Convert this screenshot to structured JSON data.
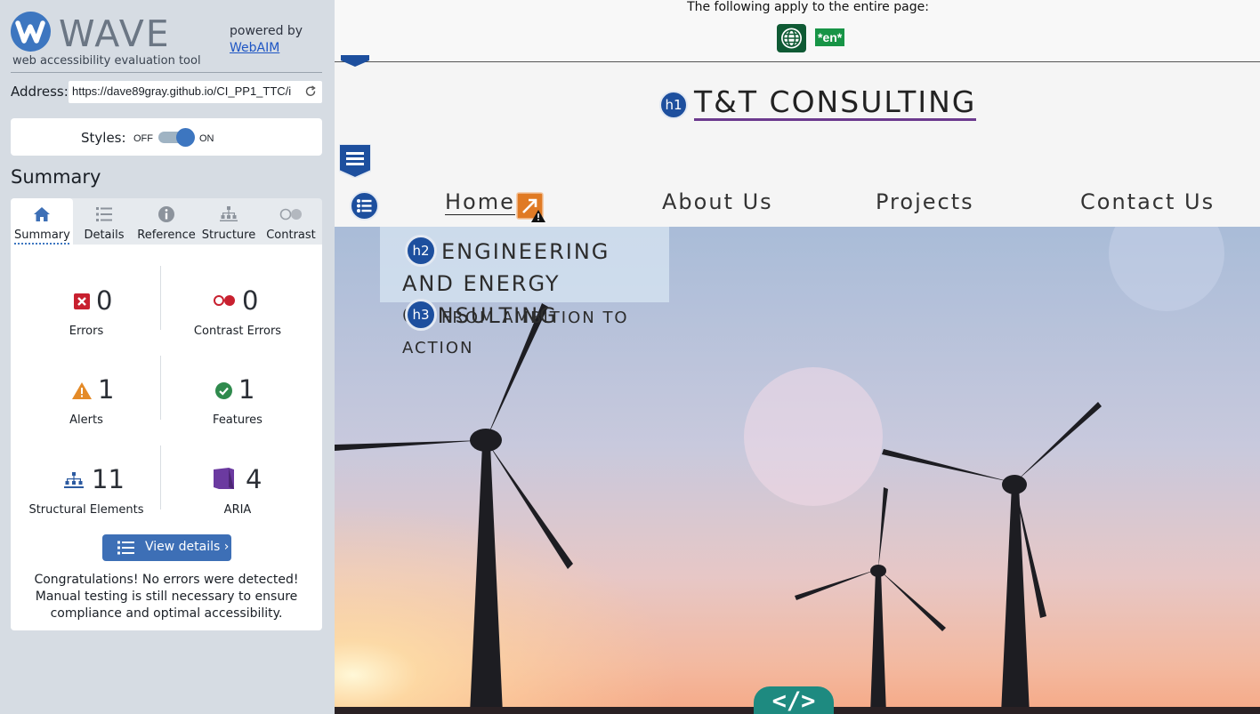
{
  "sidebar": {
    "brand": "WAVE",
    "tagline": "web accessibility evaluation tool",
    "powered_by": "powered by",
    "webaim_link": "WebAIM",
    "address_label": "Address:",
    "address_value": "https://dave89gray.github.io/CI_PP1_TTC/i",
    "styles_label": "Styles:",
    "styles_off": "OFF",
    "styles_on": "ON",
    "summary_title": "Summary",
    "tabs": [
      {
        "label": "Summary",
        "icon": "home-icon",
        "active": true
      },
      {
        "label": "Details",
        "icon": "list-icon",
        "active": false
      },
      {
        "label": "Reference",
        "icon": "info-icon",
        "active": false
      },
      {
        "label": "Structure",
        "icon": "hierarchy-icon",
        "active": false
      },
      {
        "label": "Contrast",
        "icon": "contrast-toggle-icon",
        "active": false
      }
    ],
    "stats": {
      "errors": {
        "count": "0",
        "label": "Errors",
        "color": "#c8202f"
      },
      "contrast": {
        "count": "0",
        "label": "Contrast Errors",
        "color": "#c8202f"
      },
      "alerts": {
        "count": "1",
        "label": "Alerts",
        "color": "#e48a27"
      },
      "features": {
        "count": "1",
        "label": "Features",
        "color": "#2f8a4d"
      },
      "structural": {
        "count": "11",
        "label": "Structural Elements",
        "color": "#2c5aa0"
      },
      "aria": {
        "count": "4",
        "label": "ARIA",
        "color": "#6b3aa0"
      }
    },
    "view_details": "View details ›",
    "congrats": "Congratulations! No errors were detected! Manual testing is still necessary to ensure compliance and optimal accessibility."
  },
  "page": {
    "applies_text": "The following apply to the entire page:",
    "lang_badge": "*en*",
    "h1_badge": "h1",
    "site_title": "T&T CONSULTING",
    "nav": [
      "Home",
      "About Us",
      "Projects",
      "Contact Us"
    ],
    "h2_badge": "h2",
    "h2_text": "ENGINEERING AND ENERGY CONSULTING",
    "h3_badge": "h3",
    "h3_text": "FROM AMBITION TO ACTION",
    "code_tab": "</>"
  },
  "colors": {
    "wave_blue": "#3d76c0",
    "heading_badge": "#1d4f9e",
    "title_underline": "#6c3a8e",
    "lang_green": "#179446",
    "code_tab": "#1e8a80"
  }
}
